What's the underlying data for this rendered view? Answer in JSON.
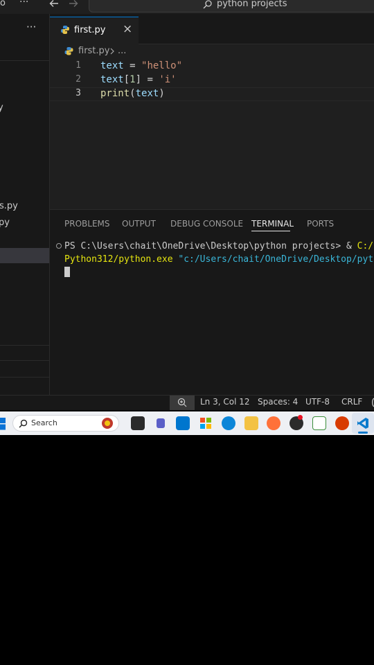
{
  "titlebar": {
    "left_glyph": "o",
    "more": "···",
    "search_text": "python projects"
  },
  "sidebar": {
    "more": "···",
    "frag1": "y",
    "frag2": "s.py",
    "frag3": "py"
  },
  "editor": {
    "tab_label": "first.py",
    "tab_close": "×",
    "breadcrumb_file": "first.py",
    "breadcrumb_more": "...",
    "lines": [
      {
        "num": "1",
        "tokens": [
          [
            "text",
            "var"
          ],
          [
            " = ",
            "op"
          ],
          [
            "\"hello\"",
            "str"
          ]
        ]
      },
      {
        "num": "2",
        "tokens": [
          [
            "text",
            "var"
          ],
          [
            "[",
            "op"
          ],
          [
            "1",
            "num"
          ],
          [
            "] = ",
            "op"
          ],
          [
            "'i'",
            "str"
          ]
        ]
      },
      {
        "num": "3",
        "tokens": [
          [
            "print",
            "fn"
          ],
          [
            "(",
            "op"
          ],
          [
            "text",
            "var"
          ],
          [
            ")",
            "op"
          ]
        ]
      }
    ]
  },
  "panel": {
    "tabs": [
      "PROBLEMS",
      "OUTPUT",
      "DEBUG CONSOLE",
      "TERMINAL",
      "PORTS"
    ],
    "active_tab": "TERMINAL",
    "terminal_line1_prompt": "PS C:\\Users\\chait\\OneDrive\\Desktop\\python projects> & ",
    "terminal_line1_cmd": "C:/U",
    "terminal_line2_exe": "Python312/python.exe ",
    "terminal_line2_arg": "\"c:/Users/chait/OneDrive/Desktop/pyth"
  },
  "statusbar": {
    "position": "Ln 3, Col 12",
    "spaces": "Spaces: 4",
    "encoding": "UTF-8",
    "eol": "CRLF"
  },
  "taskbar": {
    "search_placeholder": "Search"
  },
  "colors": {
    "accent": "#0078d4",
    "terminal_yellow": "#e5e510",
    "terminal_cyan": "#3ab6d8"
  }
}
